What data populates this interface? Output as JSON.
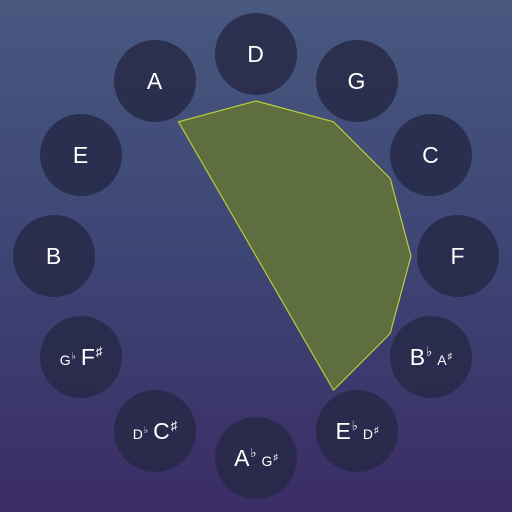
{
  "colors": {
    "background_top": "#48587f",
    "background_bottom": "#3b2c66",
    "note_circle": "#262846",
    "polygon_fill": "#5f6e3e",
    "polygon_stroke": "#b8cc3c",
    "text": "#ffffff"
  },
  "notes": [
    {
      "key": "D",
      "main": "D",
      "main_acc": "",
      "alt": "",
      "alt_acc": "",
      "alt_first": false
    },
    {
      "key": "G",
      "main": "G",
      "main_acc": "",
      "alt": "",
      "alt_acc": "",
      "alt_first": false
    },
    {
      "key": "C",
      "main": "C",
      "main_acc": "",
      "alt": "",
      "alt_acc": "",
      "alt_first": false
    },
    {
      "key": "F",
      "main": "F",
      "main_acc": "",
      "alt": "",
      "alt_acc": "",
      "alt_first": false
    },
    {
      "key": "Bb",
      "main": "B",
      "main_acc": "♭",
      "alt": "A",
      "alt_acc": "♯",
      "alt_first": false
    },
    {
      "key": "Eb",
      "main": "E",
      "main_acc": "♭",
      "alt": "D",
      "alt_acc": "♯",
      "alt_first": false
    },
    {
      "key": "Ab",
      "main": "A",
      "main_acc": "♭",
      "alt": "G",
      "alt_acc": "♯",
      "alt_first": false
    },
    {
      "key": "Db",
      "main": "C",
      "main_acc": "♯",
      "alt": "D",
      "alt_acc": "♭",
      "alt_first": true
    },
    {
      "key": "F#",
      "main": "F",
      "main_acc": "♯",
      "alt": "G",
      "alt_acc": "♭",
      "alt_first": true
    },
    {
      "key": "B",
      "main": "B",
      "main_acc": "",
      "alt": "",
      "alt_acc": "",
      "alt_first": false
    },
    {
      "key": "E",
      "main": "E",
      "main_acc": "",
      "alt": "",
      "alt_acc": "",
      "alt_first": false
    },
    {
      "key": "A",
      "main": "A",
      "main_acc": "",
      "alt": "",
      "alt_acc": "",
      "alt_first": false
    }
  ],
  "selected_note_keys": [
    "D",
    "G",
    "C",
    "F",
    "Bb",
    "Eb",
    "A"
  ]
}
